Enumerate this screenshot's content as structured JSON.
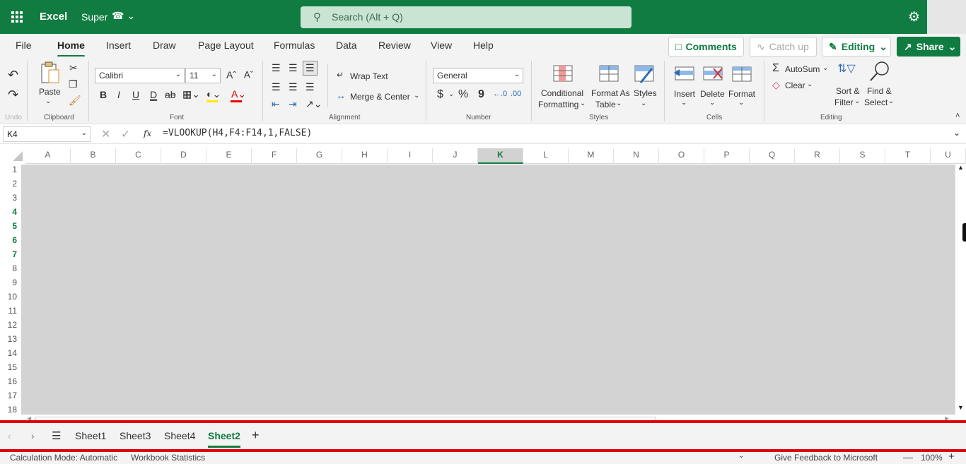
{
  "header": {
    "app_name": "Excel",
    "doc_name": "Super",
    "search_placeholder": "Search (Alt + Q)"
  },
  "ribbon_tabs": [
    "File",
    "Home",
    "Insert",
    "Draw",
    "Page Layout",
    "Formulas",
    "Data",
    "Review",
    "View",
    "Help"
  ],
  "active_tab": "Home",
  "top_buttons": {
    "comments": "Comments",
    "catch_up": "Catch up",
    "editing": "Editing",
    "share": "Share"
  },
  "ribbon": {
    "undo": {
      "label": "Undo"
    },
    "clipboard": {
      "paste": "Paste",
      "label": "Clipboard"
    },
    "font": {
      "name": "Calibri",
      "size": "11",
      "label": "Font",
      "bold": "B",
      "italic": "I",
      "underline": "U",
      "double_underline": "D",
      "strike": "ab"
    },
    "alignment": {
      "wrap_text": "Wrap Text",
      "merge_center": "Merge & Center",
      "label": "Alignment"
    },
    "number": {
      "format": "General",
      "label": "Number",
      "currency": "$",
      "percent": "%",
      "comma": "9"
    },
    "styles": {
      "conditional_1": "Conditional",
      "conditional_2": "Formatting",
      "format_table_1": "Format As",
      "format_table_2": "Table",
      "styles": "Styles",
      "label": "Styles"
    },
    "cells": {
      "insert": "Insert",
      "delete": "Delete",
      "format": "Format",
      "label": "Cells"
    },
    "editing": {
      "autosum": "AutoSum",
      "clear": "Clear",
      "sort_1": "Sort &",
      "sort_2": "Filter",
      "find_1": "Find &",
      "find_2": "Select",
      "label": "Editing"
    }
  },
  "formula_bar": {
    "cell_ref": "K4",
    "fx": "fx",
    "formula": "=VLOOKUP(H4,F4:F14,1,FALSE)"
  },
  "columns": [
    "A",
    "B",
    "C",
    "D",
    "E",
    "F",
    "G",
    "H",
    "I",
    "J",
    "K",
    "L",
    "M",
    "N",
    "O",
    "P",
    "Q",
    "R",
    "S",
    "T",
    "U"
  ],
  "selected_column": "K",
  "rows": [
    "1",
    "2",
    "3",
    "4",
    "5",
    "6",
    "7",
    "8",
    "9",
    "10",
    "11",
    "12",
    "13",
    "14",
    "15",
    "16",
    "17",
    "18"
  ],
  "selected_rows": [
    "4",
    "5",
    "6",
    "7"
  ],
  "sheets": [
    "Sheet1",
    "Sheet3",
    "Sheet4",
    "Sheet2"
  ],
  "active_sheet": "Sheet2",
  "status_bar": {
    "calc_mode": "Calculation Mode: Automatic",
    "workbook_stats": "Workbook Statistics",
    "feedback": "Give Feedback to Microsoft",
    "zoom": "100%"
  },
  "colors": {
    "brand": "#107c41",
    "highlight_red": "#e0000e"
  }
}
